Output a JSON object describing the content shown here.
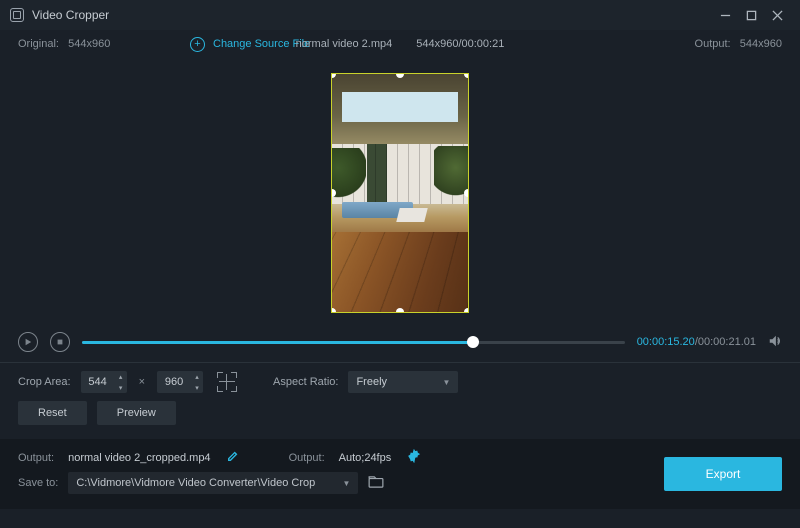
{
  "titlebar": {
    "title": "Video Cropper"
  },
  "inforow": {
    "original_label": "Original:",
    "original_size": "544x960",
    "change_source": "Change Source File",
    "filename": "normal video 2.mp4",
    "src_meta": "544x960/00:00:21",
    "output_label": "Output:",
    "output_size": "544x960"
  },
  "playbar": {
    "current": "00:00:15.20",
    "total": "00:00:21.01"
  },
  "crop": {
    "label": "Crop Area:",
    "w": "544",
    "h": "960",
    "aspect_label": "Aspect Ratio:",
    "aspect_value": "Freely",
    "reset": "Reset",
    "preview": "Preview"
  },
  "footer": {
    "output_label": "Output:",
    "output_name": "normal video 2_cropped.mp4",
    "output2_label": "Output:",
    "output2_value": "Auto;24fps",
    "save_label": "Save to:",
    "save_path": "C:\\Vidmore\\Vidmore Video Converter\\Video Crop",
    "export": "Export"
  }
}
